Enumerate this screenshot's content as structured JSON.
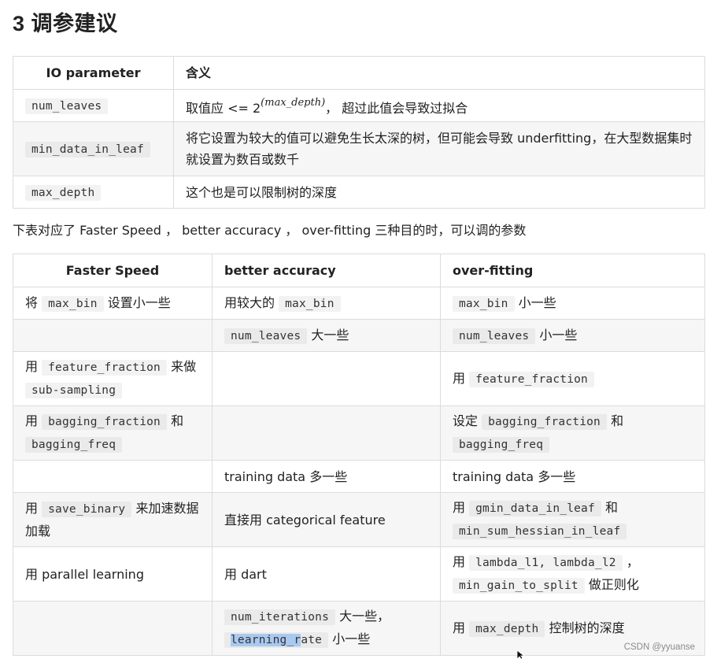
{
  "title": "3 调参建议",
  "table1": {
    "headers": [
      "IO parameter",
      "含义"
    ],
    "rows": [
      {
        "param": "num_leaves",
        "desc_pre": "取值应 <= 2",
        "desc_exp": "(max_depth)",
        "desc_post": "， 超过此值会导致过拟合"
      },
      {
        "param": "min_data_in_leaf",
        "desc": "将它设置为较大的值可以避免生长太深的树，但可能会导致 underfitting，在大型数据集时就设置为数百或数千"
      },
      {
        "param": "max_depth",
        "desc": "这个也是可以限制树的深度"
      }
    ]
  },
  "intro": "下表对应了 Faster Speed ， better accuracy ， over-fitting 三种目的时，可以调的参数",
  "table2": {
    "headers": [
      "Faster Speed",
      "better accuracy",
      "over-fitting"
    ],
    "r1": {
      "a1": "将",
      "a_code": "max_bin",
      "a2": "设置小一些",
      "b1": "用较大的",
      "b_code": "max_bin",
      "c_code": "max_bin",
      "c2": "小一些"
    },
    "r2": {
      "b_code": "num_leaves",
      "b2": "大一些",
      "c_code": "num_leaves",
      "c2": "小一些"
    },
    "r3": {
      "a1": "用",
      "a_code1": "feature_fraction",
      "a2": "来做",
      "a_code2": "sub-sampling",
      "c1": "用",
      "c_code": "feature_fraction"
    },
    "r4": {
      "a1": "用",
      "a_code1": "bagging_fraction",
      "a2": "和",
      "a_code2": "bagging_freq",
      "c1": "设定",
      "c_code1": "bagging_fraction",
      "c2": "和",
      "c_code2": "bagging_freq"
    },
    "r5": {
      "b": "training data 多一些",
      "c": "training data 多一些"
    },
    "r6": {
      "a1": "用",
      "a_code": "save_binary",
      "a2": "来加速数据加载",
      "b": "直接用 categorical feature",
      "c1": "用",
      "c_code1": "gmin_data_in_leaf",
      "c2": "和",
      "c_code2": "min_sum_hessian_in_leaf"
    },
    "r7": {
      "a": "用 parallel learning",
      "b": "用 dart",
      "c1": "用",
      "c_code1": "lambda_l1, lambda_l2",
      "c2": "，",
      "c_code2": "min_gain_to_split",
      "c3": "做正则化"
    },
    "r8": {
      "b_code1": "num_iterations",
      "b2": "大一些，",
      "b_code2_pre": "learning_r",
      "b_code2_post": "ate",
      "b3": "小一些",
      "c1": "用",
      "c_code": "max_depth",
      "c2": "控制树的深度"
    }
  },
  "watermark": "CSDN @yyuanse"
}
